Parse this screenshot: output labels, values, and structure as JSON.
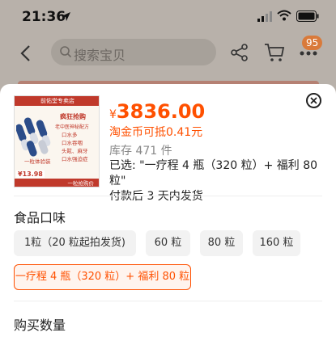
{
  "status_bar": {
    "time": "21:36"
  },
  "nav": {
    "search_placeholder": "搜索宝贝",
    "badge_count": "95"
  },
  "product_image": {
    "banner": "前佑堂专卖店",
    "headline": "疯狂抢购",
    "sub": "老中医神秘配方",
    "list": [
      "口水多",
      "口水吞咽",
      "头眩、麻牙",
      "口水强迫症"
    ],
    "note": "一粒体验装",
    "promo_price": "¥13.98",
    "footer": "一粒抢购价"
  },
  "product": {
    "price_symbol": "¥",
    "price": "3836.00",
    "coin_text": "淘金币可抵0.41元",
    "stock": "库存 471 件",
    "selected": "已选: \"一疗程 4 瓶（320 粒）+ 福利 80 粒\"",
    "shipping": "付款后 3 天内发货"
  },
  "flavor": {
    "title": "食品口味",
    "options": [
      {
        "label": "1粒（20 粒起拍发货)",
        "selected": false
      },
      {
        "label": "60 粒",
        "selected": false
      },
      {
        "label": "80 粒",
        "selected": false
      },
      {
        "label": "160 粒",
        "selected": false
      },
      {
        "label": "一疗程 4 瓶（320 粒）+ 福利 80 粒",
        "selected": true
      }
    ]
  },
  "quantity": {
    "title": "购买数量"
  },
  "colors": {
    "accent": "#ff5000",
    "badge": "#d97a3a"
  }
}
